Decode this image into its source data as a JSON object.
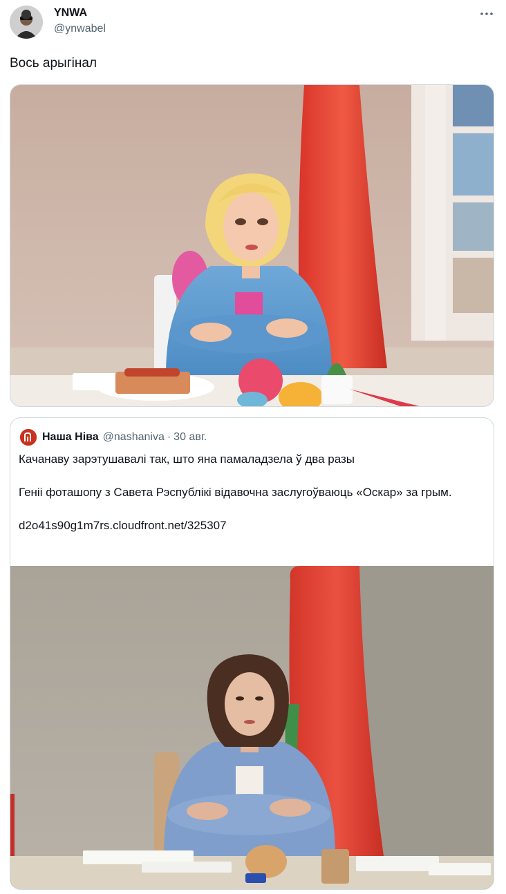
{
  "author": {
    "display_name": "YNWA",
    "handle": "@ynwabel"
  },
  "tweet": {
    "text": "Вось арыгінал"
  },
  "quoted_tweet": {
    "display_name": "Наша Ніва",
    "handle": "@nashaniva",
    "separator": "·",
    "date": "30 авг.",
    "text_line1": "Качанаву зарэтушавалі так, што яна памаладзела ў два разы",
    "text_line2": "Геніі фоташопу з Савета Рэспублікі відавочна заслугоўваюць «Оскар» за грым.",
    "link": "d2o41s90g1m7rs.cloudfront.net/325307"
  },
  "icons": {
    "more": "more-horizontal-icon",
    "quoted_avatar": "nasha-niva-logo-icon"
  },
  "colors": {
    "text_primary": "#0f1419",
    "text_secondary": "#536471",
    "border": "#cfd9de",
    "flag_red": "#e53a2c"
  }
}
